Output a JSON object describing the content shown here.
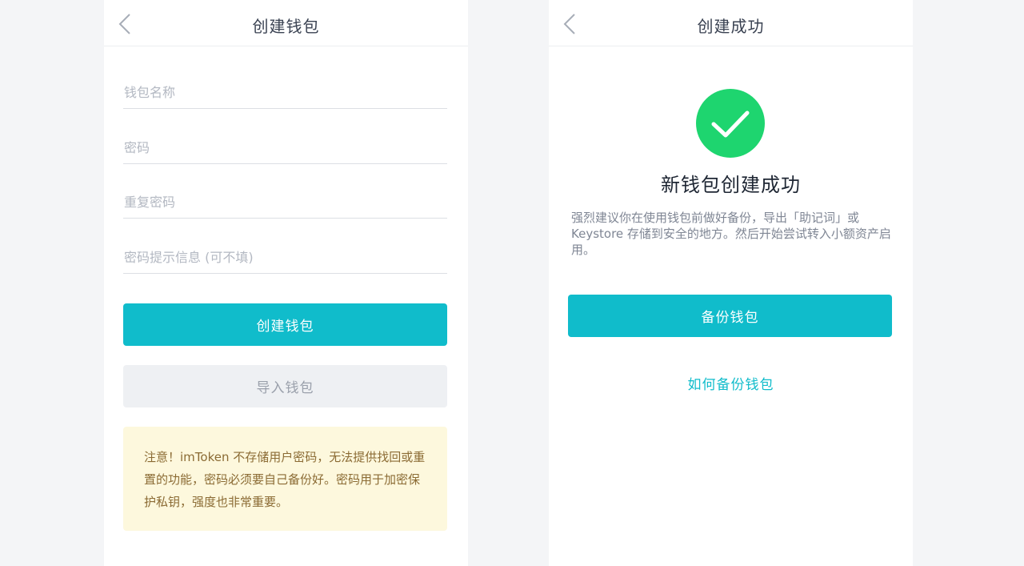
{
  "left_screen": {
    "title": "创建钱包",
    "fields": {
      "wallet_name_placeholder": "钱包名称",
      "password_placeholder": "密码",
      "repeat_password_placeholder": "重复密码",
      "hint_placeholder": "密码提示信息 (可不填)"
    },
    "create_button": "创建钱包",
    "import_button": "导入钱包",
    "notice": "注意！imToken 不存储用户密码，无法提供找回或重置的功能，密码必须要自己备份好。密码用于加密保护私钥，强度也非常重要。"
  },
  "right_screen": {
    "title": "创建成功",
    "success_title": "新钱包创建成功",
    "description": "强烈建议你在使用钱包前做好备份，导出「助记词」或 Keystore 存储到安全的地方。然后开始尝试转入小额资产启用。",
    "backup_button": "备份钱包",
    "how_to_backup_link": "如何备份钱包"
  },
  "colors": {
    "accent": "#10bccb",
    "success_green": "#1ed56f",
    "notice_bg": "#fdf8dd",
    "notice_text": "#8b6b34"
  },
  "icons": {
    "back": "chevron-left-icon",
    "success": "check-circle-icon"
  }
}
